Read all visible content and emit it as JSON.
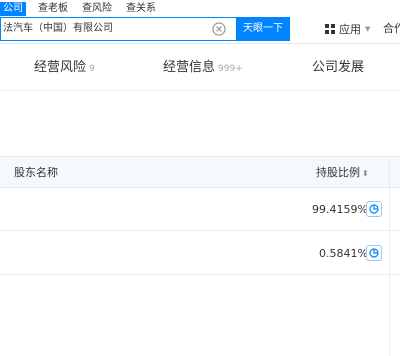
{
  "search": {
    "tabs": [
      "公司",
      "查老板",
      "查风险",
      "查关系"
    ],
    "value": "法汽车（中国）有限公司",
    "button_label": "天眼一下"
  },
  "header": {
    "apps_label": "应用",
    "coop_label": "合作"
  },
  "subtabs": [
    {
      "label": "经营风险",
      "count": "9"
    },
    {
      "label": "经营信息",
      "count": "999+"
    },
    {
      "label": "公司发展",
      "count": ""
    }
  ],
  "table": {
    "headers": {
      "name": "股东名称",
      "ratio": "持股比例"
    },
    "rows": [
      {
        "ratio": "99.4159%"
      },
      {
        "ratio": "0.5841%"
      }
    ]
  },
  "colors": {
    "accent": "#0084ff"
  }
}
